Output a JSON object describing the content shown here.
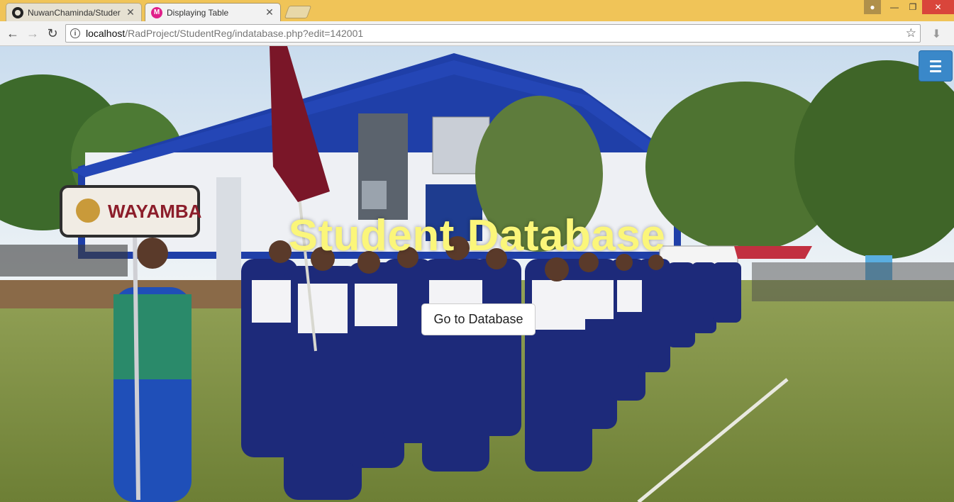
{
  "browser": {
    "tabs": [
      {
        "title": "NuwanChaminda/Studer",
        "icon": "github-icon",
        "active": false
      },
      {
        "title": "Displaying Table",
        "icon": "m-icon",
        "active": true
      }
    ],
    "url": {
      "host": "localhost",
      "path": "/RadProject/StudentReg/indatabase.php?edit=142001"
    }
  },
  "page": {
    "hero_title": "Student Database",
    "cta_label": "Go to Database",
    "sign_text": "WAYAMBA"
  },
  "colors": {
    "hero_title": "#fbf67a",
    "menu_button": "#3a88c9",
    "tabbar": "#f0c458"
  }
}
